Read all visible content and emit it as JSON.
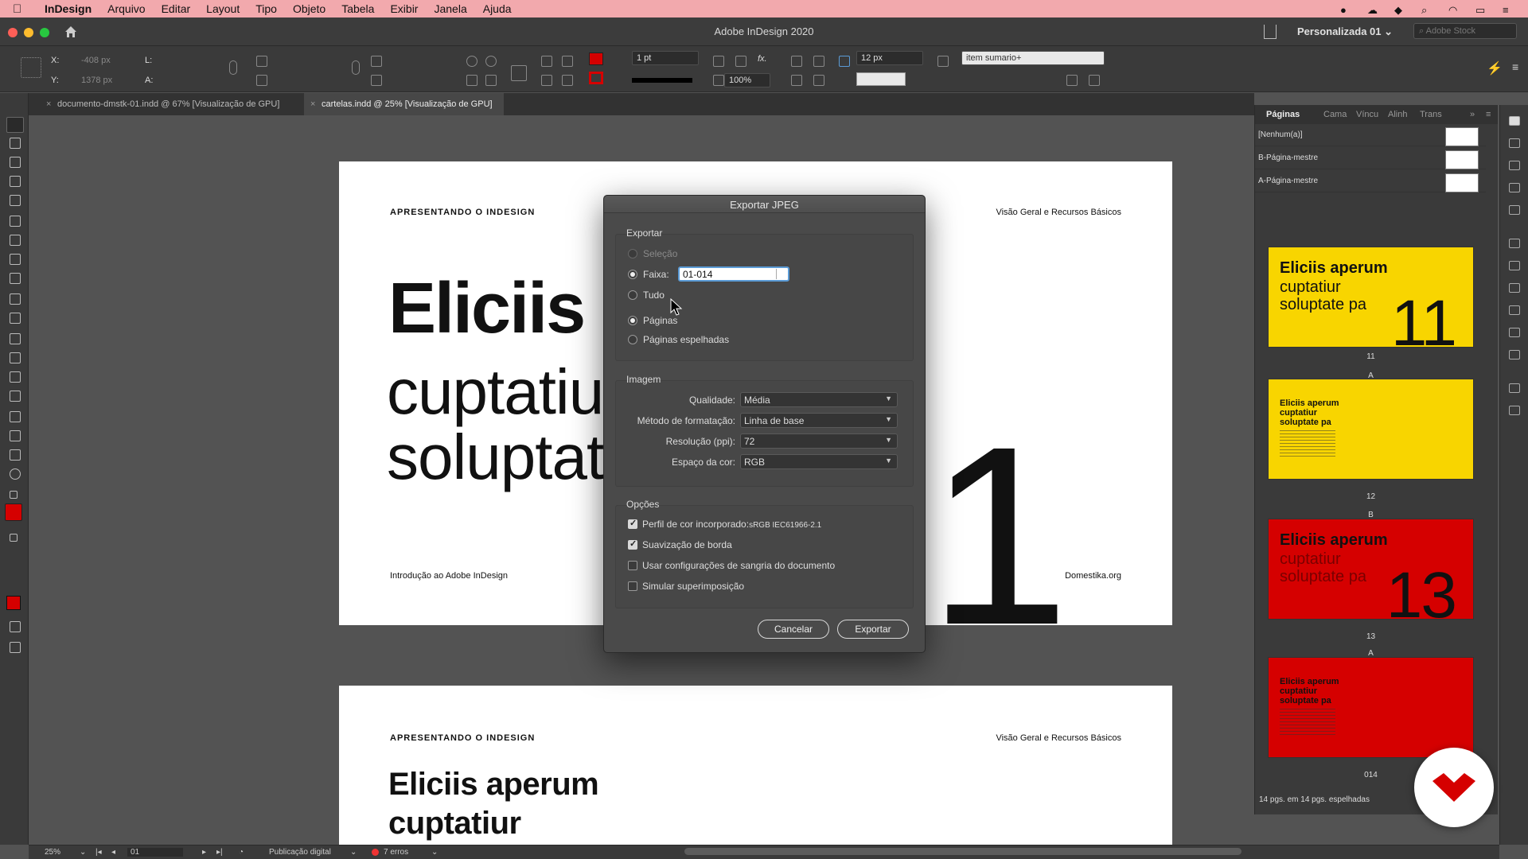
{
  "menubar": {
    "app": "InDesign",
    "items": [
      "Arquivo",
      "Editar",
      "Layout",
      "Tipo",
      "Objeto",
      "Tabela",
      "Exibir",
      "Janela",
      "Ajuda"
    ]
  },
  "window": {
    "title": "Adobe InDesign 2020",
    "workspace": "Personalizada 01",
    "search_placeholder": "Adobe Stock"
  },
  "control": {
    "x_label": "X:",
    "x_value": "-408 px",
    "y_label": "Y:",
    "y_value": "1378 px",
    "w_label": "L:",
    "h_label": "A:",
    "stroke_weight": "1 pt",
    "zoom_pct": "100%",
    "spacing": "12 px",
    "object_style": "item sumario+"
  },
  "tabs": [
    {
      "label": "documento-dmstk-01.indd @ 67% [Visualização de GPU]",
      "active": false
    },
    {
      "label": "cartelas.indd @ 25% [Visualização de GPU]",
      "active": true
    }
  ],
  "page1": {
    "header_left": "APRESENTANDO O INDESIGN",
    "header_right": "Visão Geral e Recursos Básicos",
    "title_bold": "Eliciis a",
    "title_light_1": "cuptatiu",
    "title_light_2": "soluptat",
    "big_number": "1",
    "footer_left": "Introdução ao Adobe InDesign",
    "footer_right": "Domestika.org"
  },
  "page2": {
    "header_left": "APRESENTANDO O INDESIGN",
    "header_right": "Visão Geral e Recursos Básicos",
    "title_line_1": "Eliciis aperum",
    "title_line_2": "cuptatiur"
  },
  "dialog": {
    "title": "Exportar JPEG",
    "export_group": "Exportar",
    "opt_selection": "Seleção",
    "opt_range": "Faixa:",
    "range_value": "01-014",
    "opt_all": "Tudo",
    "opt_pages": "Páginas",
    "opt_spreads": "Páginas espelhadas",
    "image_group": "Imagem",
    "quality_label": "Qualidade:",
    "quality_value": "Média",
    "format_label": "Método de formatação:",
    "format_value": "Linha de base",
    "resolution_label": "Resolução (ppi):",
    "resolution_value": "72",
    "colorspace_label": "Espaço da cor:",
    "colorspace_value": "RGB",
    "options_group": "Opções",
    "opt_profile": "Perfil de cor incorporado:",
    "opt_profile_value": "sRGB IEC61966-2.1",
    "opt_antialias": "Suavização de borda",
    "opt_bleed": "Usar configurações de sangria do documento",
    "opt_overprint": "Simular superimposição",
    "checks": {
      "profile": true,
      "antialias": true,
      "bleed": false,
      "overprint": false
    },
    "cancel": "Cancelar",
    "export": "Exportar"
  },
  "pages_panel": {
    "tabs": [
      "Páginas",
      "Cama",
      "Víncu",
      "Alinh",
      "Trans"
    ],
    "masters": [
      "[Nenhum(a)]",
      "B-Página-mestre",
      "A-Página-mestre"
    ],
    "thumbs": [
      {
        "label": "11",
        "title": "Eliciis aperum",
        "sub1": "cuptatiur",
        "sub2": "soluptate pa",
        "num": "11",
        "color": "#f8d500",
        "master": ""
      },
      {
        "label": "12",
        "title": "Eliciis aperum",
        "sub1": "cuptatiur",
        "sub2": "soluptate pa",
        "num": "",
        "color": "#f8d500",
        "master": "A"
      },
      {
        "label": "13",
        "title": "Eliciis aperum",
        "sub1": "cuptatiur",
        "sub2": "soluptate pa",
        "num": "13",
        "color": "#d50000",
        "master": "B"
      },
      {
        "label": "014",
        "title": "Eliciis aperum",
        "sub1": "cuptatiur",
        "sub2": "soluptate pa",
        "num": "",
        "color": "#d50000",
        "master": "A"
      }
    ],
    "status": "14 pgs. em 14 pgs. espelhadas"
  },
  "statusbar": {
    "zoom": "25%",
    "page": "01",
    "preflight_profile": "Publicação digital",
    "errors": "7 erros"
  },
  "colors": {
    "menubar": "#f2a9ad",
    "accent_red": "#d50000",
    "accent_yellow": "#f8d500",
    "focus_blue": "#5b9bd6"
  }
}
